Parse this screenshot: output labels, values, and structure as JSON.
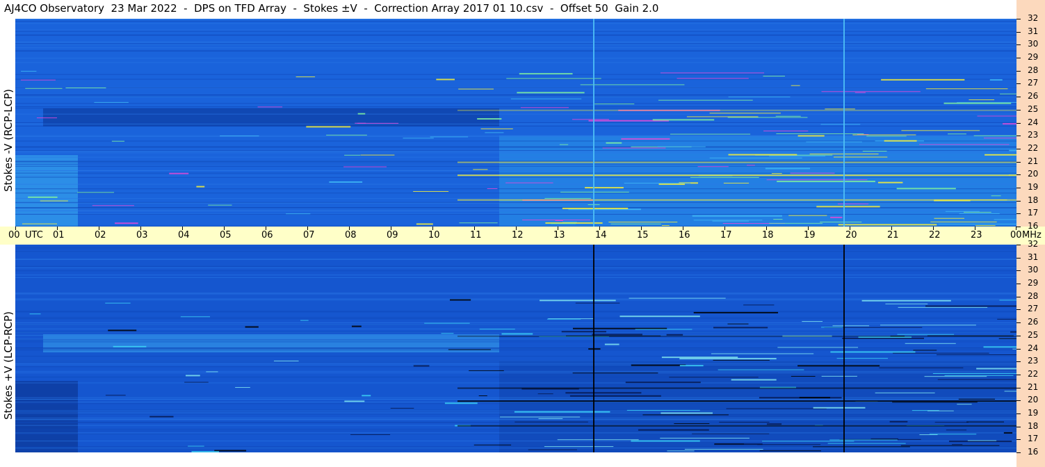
{
  "title": "AJ4CO Observatory  23 Mar 2022  -  DPS on TFD Array  -  Stokes ±V  -  Correction Array 2017 01 10.csv  -  Offset 50  Gain 2.0",
  "panels": [
    {
      "ylabel": "Stokes -V (RCP-LCP)"
    },
    {
      "ylabel": "Stokes +V (LCP-RCP)"
    }
  ],
  "chart_data": {
    "type": "heatmap",
    "x_axis": {
      "unit_label": "UTC",
      "ticks": [
        "00",
        "01",
        "02",
        "03",
        "04",
        "05",
        "06",
        "07",
        "08",
        "09",
        "10",
        "11",
        "12",
        "13",
        "14",
        "15",
        "16",
        "17",
        "18",
        "19",
        "20",
        "21",
        "22",
        "23",
        "00"
      ],
      "range_hours": [
        0,
        24
      ]
    },
    "y_axis": {
      "unit_label": "MHz",
      "ticks": [
        "32",
        "31",
        "30",
        "29",
        "28",
        "27",
        "26",
        "25",
        "24",
        "23",
        "22",
        "21",
        "20",
        "19",
        "18",
        "17",
        "16"
      ],
      "range_mhz": [
        16,
        32
      ]
    },
    "panels": [
      "Stokes -V (RCP-LCP)",
      "Stokes +V (LCP-RCP)"
    ],
    "colors": {
      "background_blue": "#1a5fd6",
      "deep_blue": "#0c3fa8",
      "cyan": "#3fb7f5",
      "yellow": "#f4ee3a",
      "magenta": "#e04ad8",
      "timebar": "#ffffc8",
      "freqbar": "#fcd9bd"
    },
    "features": {
      "vertical_lines_utc": [
        13.85,
        19.85
      ],
      "daytime_enhancement_utc": [
        11.6,
        24
      ]
    }
  }
}
